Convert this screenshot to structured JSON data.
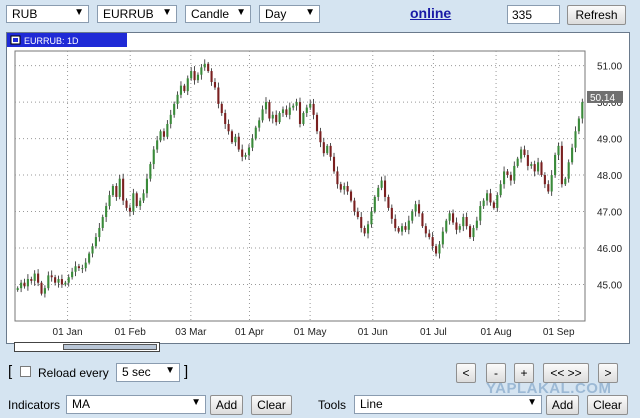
{
  "toolbar": {
    "currency": "RUB",
    "symbol": "EURRUB",
    "chart_type": "Candle",
    "period": "Day",
    "online_link": "online",
    "count_value": "335",
    "refresh_label": "Refresh"
  },
  "chart_label": "EURRUB: 1D",
  "price_badge": "50.14",
  "icons": {
    "dropdown": "chevron-down-icon",
    "chart_badge": "chart-window-icon"
  },
  "colors": {
    "up": "#3a8a3a",
    "down": "#7a2020",
    "wick": "#222222",
    "badge": "#6f6f6f",
    "link": "#1a1aa6",
    "panel": "#d5e4f1"
  },
  "controls": {
    "reload_label": "Reload every",
    "reload_interval": "5 sec",
    "nav_prev": "<",
    "nav_zoom_out": "-",
    "nav_zoom_in": "+",
    "nav_expand": "<< >>",
    "nav_next": ">",
    "indicators_label": "Indicators",
    "indicator_value": "MA",
    "tools_label": "Tools",
    "tool_value": "Line",
    "add_label": "Add",
    "clear_label": "Clear"
  },
  "watermark": "YAPLAKAL.COM",
  "chart_data": {
    "type": "candlestick",
    "title": "EURRUB: 1D",
    "y_ticks": [
      45,
      46,
      47,
      48,
      49,
      50,
      51
    ],
    "ylim": [
      44.0,
      51.4
    ],
    "x_ticks": [
      {
        "label": "01 Jan",
        "day": 0
      },
      {
        "label": "01 Feb",
        "day": 31
      },
      {
        "label": "03 Mar",
        "day": 61
      },
      {
        "label": "01 Apr",
        "day": 90
      },
      {
        "label": "01 May",
        "day": 120
      },
      {
        "label": "01 Jun",
        "day": 151
      },
      {
        "label": "01 Jul",
        "day": 181
      },
      {
        "label": "01 Aug",
        "day": 212
      },
      {
        "label": "01 Sep",
        "day": 243
      }
    ],
    "xlim": [
      -26,
      256
    ],
    "grid": true,
    "last_value": 50.14,
    "candles_open_close": [
      [
        44.85,
        44.9
      ],
      [
        44.9,
        45.05
      ],
      [
        45.05,
        44.95
      ],
      [
        44.95,
        45.15
      ],
      [
        45.15,
        45.1
      ],
      [
        45.1,
        45.3
      ],
      [
        45.3,
        45.05
      ],
      [
        45.05,
        44.75
      ],
      [
        44.75,
        44.9
      ],
      [
        44.9,
        45.25
      ],
      [
        45.25,
        45.2
      ],
      [
        45.2,
        45.05
      ],
      [
        45.05,
        45.15
      ],
      [
        45.15,
        45.0
      ],
      [
        45.0,
        45.05
      ],
      [
        45.05,
        45.2
      ],
      [
        45.2,
        45.35
      ],
      [
        45.35,
        45.5
      ],
      [
        45.5,
        45.45
      ],
      [
        45.45,
        45.45
      ],
      [
        45.45,
        45.6
      ],
      [
        45.6,
        45.85
      ],
      [
        45.85,
        46.05
      ],
      [
        46.05,
        46.3
      ],
      [
        46.3,
        46.55
      ],
      [
        46.55,
        46.85
      ],
      [
        46.85,
        47.15
      ],
      [
        47.15,
        47.45
      ],
      [
        47.45,
        47.7
      ],
      [
        47.7,
        47.4
      ],
      [
        47.4,
        47.9
      ],
      [
        47.9,
        47.3
      ],
      [
        47.3,
        47.1
      ],
      [
        47.1,
        47.0
      ],
      [
        47.0,
        47.5
      ],
      [
        47.5,
        47.15
      ],
      [
        47.15,
        47.3
      ],
      [
        47.3,
        47.5
      ],
      [
        47.5,
        47.9
      ],
      [
        47.9,
        48.3
      ],
      [
        48.3,
        48.7
      ],
      [
        48.7,
        48.95
      ],
      [
        48.95,
        49.2
      ],
      [
        49.2,
        49.05
      ],
      [
        49.05,
        49.4
      ],
      [
        49.4,
        49.65
      ],
      [
        49.65,
        49.95
      ],
      [
        49.95,
        50.2
      ],
      [
        50.2,
        50.45
      ],
      [
        50.45,
        50.3
      ],
      [
        50.3,
        50.65
      ],
      [
        50.65,
        50.85
      ],
      [
        50.85,
        50.6
      ],
      [
        50.6,
        50.75
      ],
      [
        50.75,
        50.95
      ],
      [
        50.95,
        51.05
      ],
      [
        51.05,
        50.85
      ],
      [
        50.85,
        50.55
      ],
      [
        50.55,
        50.4
      ],
      [
        50.4,
        49.95
      ],
      [
        49.95,
        49.7
      ],
      [
        49.7,
        49.4
      ],
      [
        49.4,
        49.2
      ],
      [
        49.2,
        48.9
      ],
      [
        48.9,
        49.05
      ],
      [
        49.05,
        48.7
      ],
      [
        48.7,
        48.5
      ],
      [
        48.5,
        48.55
      ],
      [
        48.55,
        48.75
      ],
      [
        48.75,
        49.0
      ],
      [
        49.0,
        49.3
      ],
      [
        49.3,
        49.5
      ],
      [
        49.5,
        49.8
      ],
      [
        49.8,
        50.0
      ],
      [
        50.0,
        49.55
      ],
      [
        49.55,
        49.65
      ],
      [
        49.65,
        49.45
      ],
      [
        49.45,
        49.7
      ],
      [
        49.7,
        49.8
      ],
      [
        49.8,
        49.65
      ],
      [
        49.65,
        49.85
      ],
      [
        49.85,
        49.9
      ],
      [
        49.9,
        50.0
      ],
      [
        50.0,
        49.4
      ],
      [
        49.4,
        49.7
      ],
      [
        49.7,
        49.85
      ],
      [
        49.85,
        49.95
      ],
      [
        49.95,
        49.65
      ],
      [
        49.65,
        49.2
      ],
      [
        49.2,
        48.9
      ],
      [
        48.9,
        48.6
      ],
      [
        48.6,
        48.8
      ],
      [
        48.8,
        48.5
      ],
      [
        48.5,
        48.1
      ],
      [
        48.1,
        47.75
      ],
      [
        47.75,
        47.6
      ],
      [
        47.6,
        47.7
      ],
      [
        47.7,
        47.55
      ],
      [
        47.55,
        47.3
      ],
      [
        47.3,
        47.0
      ],
      [
        47.0,
        46.85
      ],
      [
        46.85,
        46.55
      ],
      [
        46.55,
        46.4
      ],
      [
        46.4,
        46.65
      ],
      [
        46.65,
        47.0
      ],
      [
        47.0,
        47.4
      ],
      [
        47.4,
        47.65
      ],
      [
        47.65,
        47.85
      ],
      [
        47.85,
        47.4
      ],
      [
        47.4,
        47.1
      ],
      [
        47.1,
        46.8
      ],
      [
        46.8,
        46.55
      ],
      [
        46.55,
        46.45
      ],
      [
        46.45,
        46.6
      ],
      [
        46.6,
        46.5
      ],
      [
        46.5,
        46.75
      ],
      [
        46.75,
        47.0
      ],
      [
        47.0,
        47.2
      ],
      [
        47.2,
        46.95
      ],
      [
        46.95,
        46.6
      ],
      [
        46.6,
        46.4
      ],
      [
        46.4,
        46.3
      ],
      [
        46.3,
        46.05
      ],
      [
        46.05,
        45.85
      ],
      [
        45.85,
        46.1
      ],
      [
        46.1,
        46.45
      ],
      [
        46.45,
        46.75
      ],
      [
        46.75,
        46.95
      ],
      [
        46.95,
        46.7
      ],
      [
        46.7,
        46.5
      ],
      [
        46.5,
        46.6
      ],
      [
        46.6,
        46.85
      ],
      [
        46.85,
        46.6
      ],
      [
        46.6,
        46.3
      ],
      [
        46.3,
        46.55
      ],
      [
        46.55,
        46.75
      ],
      [
        46.75,
        47.15
      ],
      [
        47.15,
        47.3
      ],
      [
        47.3,
        47.5
      ],
      [
        47.5,
        47.25
      ],
      [
        47.25,
        47.1
      ],
      [
        47.1,
        47.45
      ],
      [
        47.45,
        47.75
      ],
      [
        47.75,
        48.1
      ],
      [
        48.1,
        48.0
      ],
      [
        48.0,
        47.85
      ],
      [
        47.85,
        48.25
      ],
      [
        48.25,
        48.45
      ],
      [
        48.45,
        48.7
      ],
      [
        48.7,
        48.55
      ],
      [
        48.55,
        48.25
      ],
      [
        48.25,
        48.3
      ],
      [
        48.3,
        48.1
      ],
      [
        48.1,
        48.35
      ],
      [
        48.35,
        48.0
      ],
      [
        48.0,
        47.75
      ],
      [
        47.75,
        47.55
      ],
      [
        47.55,
        48.0
      ],
      [
        48.0,
        48.55
      ],
      [
        48.55,
        48.8
      ],
      [
        48.8,
        47.75
      ],
      [
        47.75,
        47.9
      ],
      [
        47.9,
        48.35
      ],
      [
        48.35,
        48.75
      ],
      [
        48.75,
        49.2
      ],
      [
        49.2,
        49.55
      ],
      [
        49.55,
        50.0
      ]
    ]
  }
}
